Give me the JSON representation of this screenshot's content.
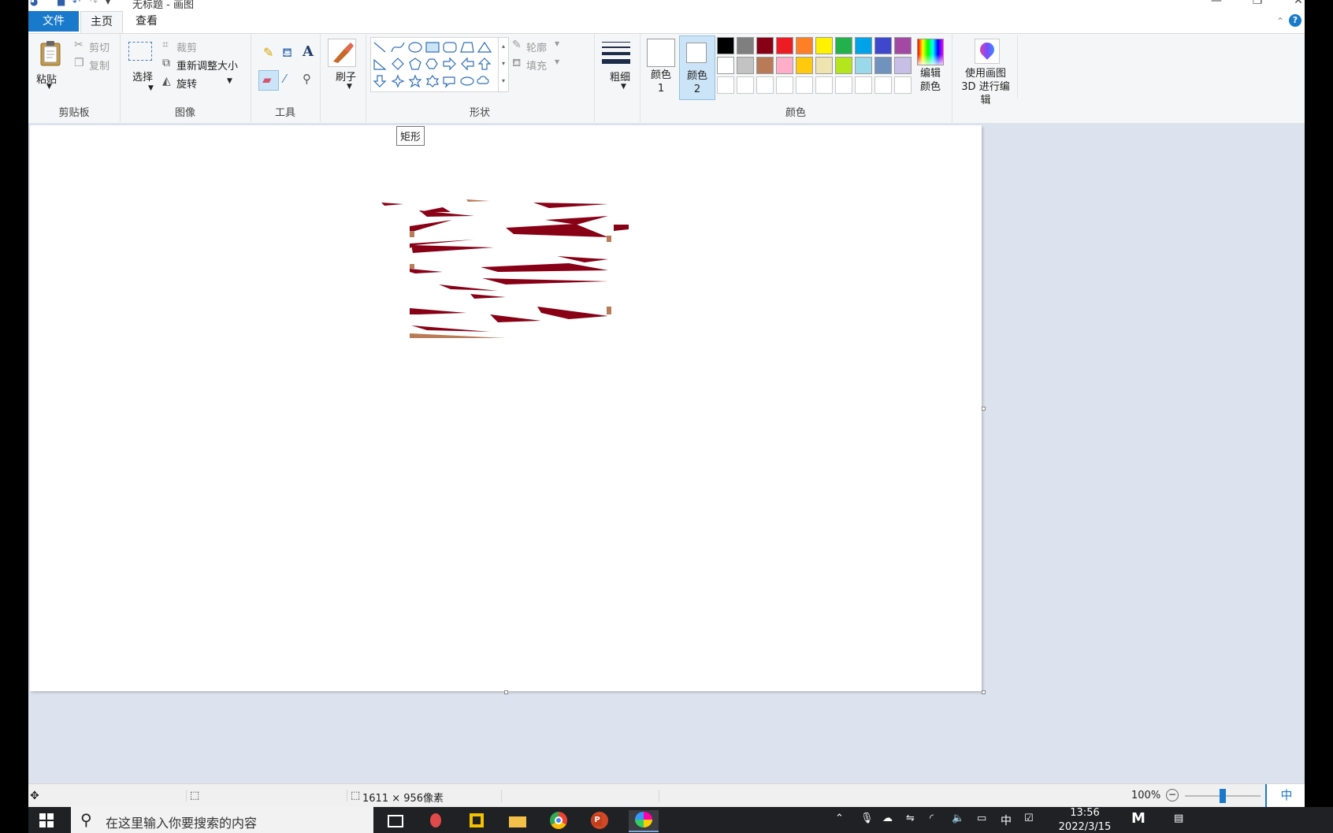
{
  "titlebar": {
    "title": "无标题 - 画图"
  },
  "menubar": {
    "tabs": [
      "文件",
      "主页",
      "查看"
    ],
    "active_tab": "主页"
  },
  "ribbon": {
    "clipboard": {
      "paste": "粘贴",
      "cut": "剪切",
      "copy": "复制",
      "group_label": "剪贴板"
    },
    "image": {
      "select": "选择",
      "crop": "裁剪",
      "resize": "重新调整大小",
      "rotate": "旋转",
      "group_label": "图像"
    },
    "tools": {
      "group_label": "工具",
      "brush": "刷子"
    },
    "shapes": {
      "outline": "轮廓",
      "fill": "填充",
      "group_label": "形状"
    },
    "size": {
      "label": "粗细"
    },
    "colors": {
      "color1": "颜色 1",
      "color2": "颜色 2",
      "edit_colors": "编辑颜色",
      "paint3d": "使用画图 3D 进行编辑",
      "group_label": "颜色",
      "palette_row1": [
        "#000000",
        "#7f7f7f",
        "#880015",
        "#ed1c24",
        "#ff7f27",
        "#fff200",
        "#22b14c",
        "#00a2e8",
        "#3f48cc",
        "#a349a4"
      ],
      "palette_row2": [
        "#ffffff",
        "#c3c3c3",
        "#b97a57",
        "#ffaec9",
        "#ffc90e",
        "#efe4b0",
        "#b5e61d",
        "#99d9ea",
        "#7092be",
        "#c8bfe7"
      ]
    }
  },
  "canvas": {
    "tooltip": "矩形"
  },
  "statusbar": {
    "dimensions": "1611 × 956像素",
    "zoom": "100%",
    "ime": "中"
  },
  "taskbar": {
    "search_placeholder": "在这里输入你要搜索的内容",
    "time": "13:56",
    "date": "2022/3/15",
    "ime": "中"
  }
}
